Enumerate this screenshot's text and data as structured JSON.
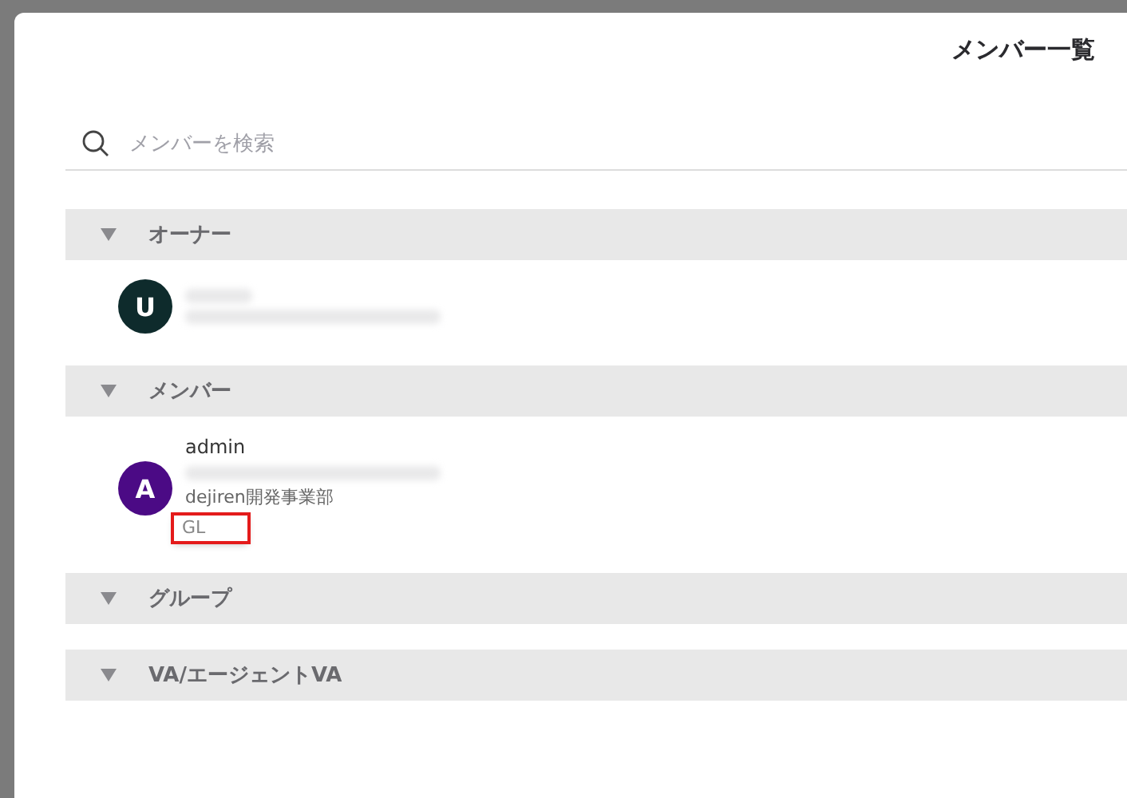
{
  "dialog": {
    "title": "メンバー一覧"
  },
  "search": {
    "placeholder": "メンバーを検索"
  },
  "sections": [
    {
      "label": "オーナー",
      "expanded": true,
      "members": [
        {
          "initial": "U",
          "color": "#0e2b2c",
          "name_blurred": true,
          "email_blurred": true
        }
      ]
    },
    {
      "label": "メンバー",
      "expanded": true,
      "members": [
        {
          "initial": "A",
          "color": "#4b0a85",
          "name": "admin",
          "email_blurred": true,
          "department": "dejiren開発事業部",
          "role": "GL",
          "role_highlighted": true
        }
      ]
    },
    {
      "label": "グループ",
      "expanded": true
    },
    {
      "label": "VA/エージェントVA",
      "expanded": true
    }
  ]
}
